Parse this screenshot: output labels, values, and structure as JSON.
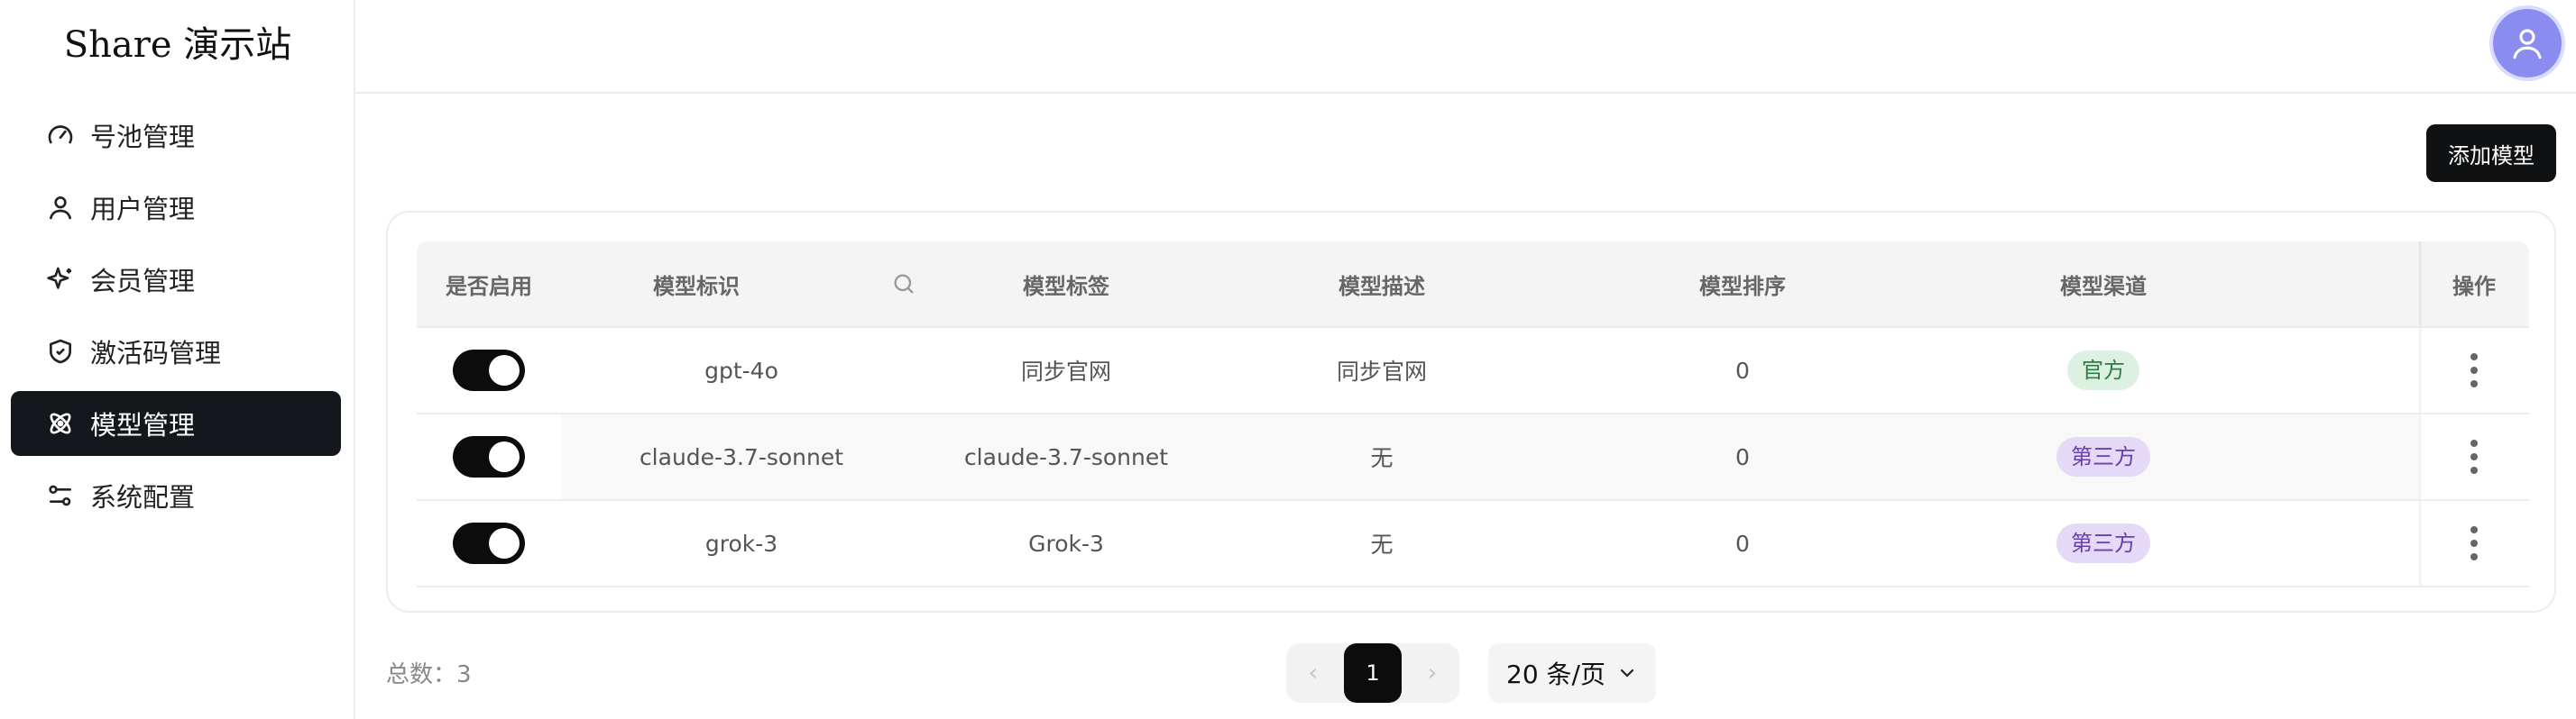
{
  "brand": {
    "title": "Share 演示站"
  },
  "sidebar": {
    "items": [
      {
        "label": "号池管理",
        "icon": "gauge-icon"
      },
      {
        "label": "用户管理",
        "icon": "user-icon"
      },
      {
        "label": "会员管理",
        "icon": "sparkles-icon"
      },
      {
        "label": "激活码管理",
        "icon": "shield-check-icon"
      },
      {
        "label": "模型管理",
        "icon": "atom-icon",
        "active": true
      },
      {
        "label": "系统配置",
        "icon": "sliders-icon"
      }
    ]
  },
  "header": {
    "avatar_icon": "user-avatar-icon"
  },
  "toolbar": {
    "add_label": "添加模型"
  },
  "table": {
    "headers": [
      "是否启用",
      "模型标识",
      "模型标签",
      "模型描述",
      "模型排序",
      "模型渠道",
      "操作"
    ],
    "rows": [
      {
        "enabled": true,
        "id": "gpt-4o",
        "label": "同步官网",
        "desc": "同步官网",
        "sort": "0",
        "channel": "官方",
        "channel_color": "green"
      },
      {
        "enabled": true,
        "id": "claude-3.7-sonnet",
        "label": "claude-3.7-sonnet",
        "desc": "无",
        "sort": "0",
        "channel": "第三方",
        "channel_color": "purple"
      },
      {
        "enabled": true,
        "id": "grok-3",
        "label": "Grok-3",
        "desc": "无",
        "sort": "0",
        "channel": "第三方",
        "channel_color": "purple"
      }
    ]
  },
  "footer": {
    "total_label": "总数：",
    "total_value": "3",
    "current_page": "1",
    "page_size": "20 条/页"
  },
  "colors": {
    "accent": "#14181c",
    "avatar": "#8a8cf0",
    "badge_green": "#dcf1e1",
    "badge_purple": "#e4d9f6"
  }
}
